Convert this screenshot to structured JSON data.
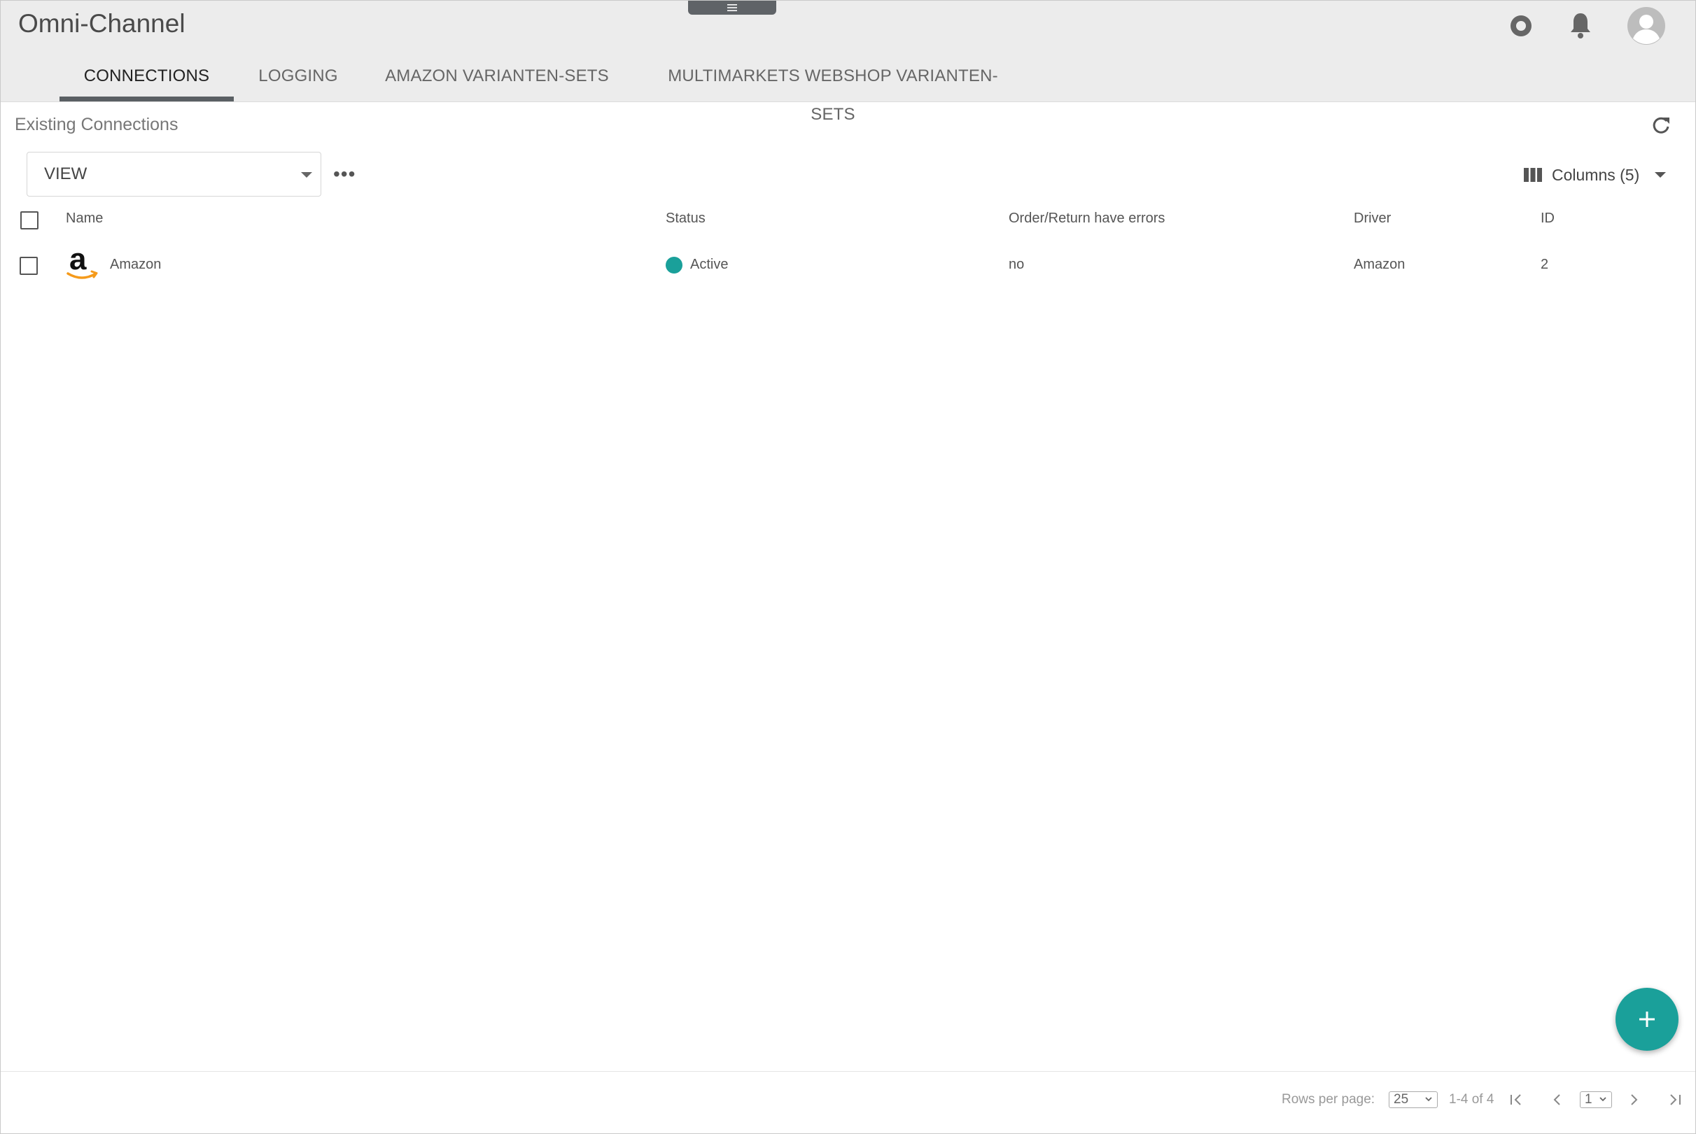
{
  "app": {
    "title": "Omni-Channel"
  },
  "tabs": [
    {
      "label": "CONNECTIONS",
      "active": true
    },
    {
      "label": "LOGGING",
      "active": false
    },
    {
      "label": "AMAZON VARIANTEN-SETS",
      "active": false
    },
    {
      "label": "MULTIMARKETS WEBSHOP VARIANTEN-SETS",
      "active": false
    }
  ],
  "section": {
    "title": "Existing Connections"
  },
  "toolbar": {
    "view_label": "VIEW",
    "more_label": "•••",
    "columns_label": "Columns (5)"
  },
  "table": {
    "headers": [
      "Name",
      "Status",
      "Order/Return have errors",
      "Driver",
      "ID"
    ],
    "rows": [
      {
        "name": "Amazon",
        "status": "Active",
        "errors": "no",
        "driver": "Amazon",
        "id": "2"
      }
    ]
  },
  "pagination": {
    "rows_per_page_label": "Rows per page:",
    "rows_per_page_value": "25",
    "range_label": "1-4 of 4",
    "page_value": "1"
  },
  "icons": {
    "record": "record-icon",
    "bell": "bell-icon",
    "avatar": "avatar-icon",
    "refresh": "refresh-icon",
    "columns": "columns-icon",
    "add": "plus-icon"
  },
  "colors": {
    "accent": "#1aa09a",
    "status_active": "#1aa09a",
    "topbar": "#ececec"
  }
}
